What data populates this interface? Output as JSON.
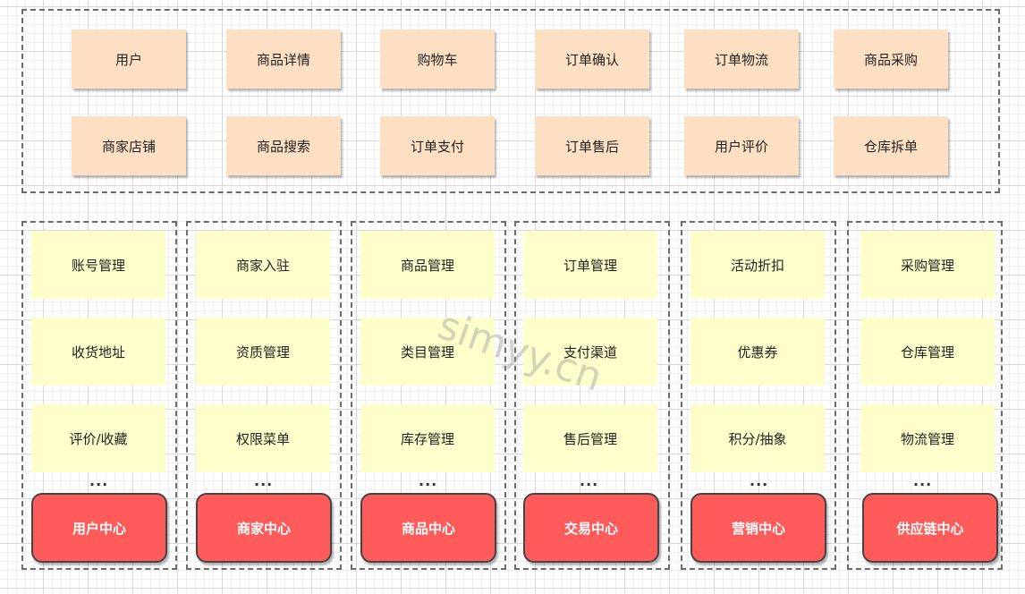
{
  "features_row1": [
    "用户",
    "商品详情",
    "购物车",
    "订单确认",
    "订单物流",
    "商品采购"
  ],
  "features_row2": [
    "商家店铺",
    "商品搜索",
    "订单支付",
    "订单售后",
    "用户评价",
    "仓库拆单"
  ],
  "columns": [
    {
      "items": [
        "账号管理",
        "收货地址",
        "评价/收藏"
      ],
      "more": "...",
      "center": "用户中心"
    },
    {
      "items": [
        "商家入驻",
        "资质管理",
        "权限菜单"
      ],
      "more": "...",
      "center": "商家中心"
    },
    {
      "items": [
        "商品管理",
        "类目管理",
        "库存管理"
      ],
      "more": "...",
      "center": "商品中心"
    },
    {
      "items": [
        "订单管理",
        "支付渠道",
        "售后管理"
      ],
      "more": "...",
      "center": "交易中心"
    },
    {
      "items": [
        "活动折扣",
        "优惠券",
        "积分/抽象"
      ],
      "more": "...",
      "center": "营销中心"
    },
    {
      "items": [
        "采购管理",
        "仓库管理",
        "物流管理"
      ],
      "more": "...",
      "center": "供应链中心"
    }
  ],
  "watermark": "simyy.cn"
}
